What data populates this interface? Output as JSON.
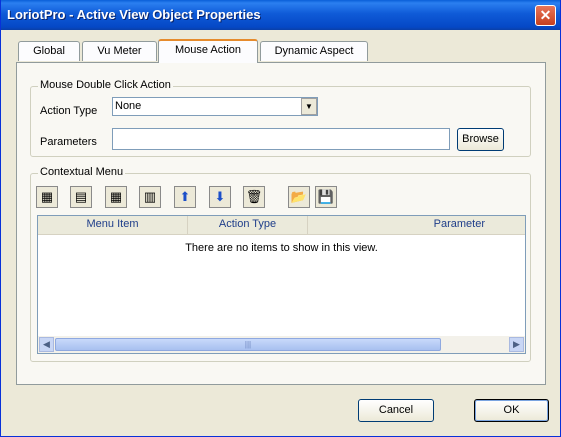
{
  "window": {
    "title": "LoriotPro - Active View Object Properties"
  },
  "tabs": [
    {
      "label": "Global",
      "active": false
    },
    {
      "label": "Vu Meter",
      "active": false
    },
    {
      "label": "Mouse Action",
      "active": true
    },
    {
      "label": "Dynamic Aspect",
      "active": false
    }
  ],
  "mouse_action": {
    "group_label": "Mouse Double Click Action",
    "action_type_label": "Action Type",
    "action_type_value": "None",
    "parameters_label": "Parameters",
    "parameters_value": "",
    "browse_label": "Browse"
  },
  "contextual_menu": {
    "group_label": "Contextual Menu",
    "toolbar": [
      {
        "icon": "add-item-icon",
        "glyph": "▦"
      },
      {
        "icon": "insert-item-icon",
        "glyph": "▤"
      },
      {
        "icon": "edit-item-icon",
        "glyph": "▦"
      },
      {
        "icon": "delete-item-icon",
        "glyph": "▥"
      },
      {
        "icon": "arrow-up-icon",
        "glyph": "⬆"
      },
      {
        "icon": "arrow-down-icon",
        "glyph": "⬇"
      },
      {
        "icon": "trash-icon",
        "glyph": "🗑"
      },
      {
        "icon": "open-folder-icon",
        "glyph": "📂"
      },
      {
        "icon": "save-icon",
        "glyph": "💾"
      }
    ],
    "columns": [
      "Menu Item",
      "Action Type",
      "Parameter"
    ],
    "empty_text": "There are no items to show in this view."
  },
  "buttons": {
    "cancel": "Cancel",
    "ok": "OK"
  },
  "colors": {
    "title_bar": "#0548c6",
    "tab_highlight": "#e68b2c",
    "dialog_bg": "#ece9d8"
  }
}
